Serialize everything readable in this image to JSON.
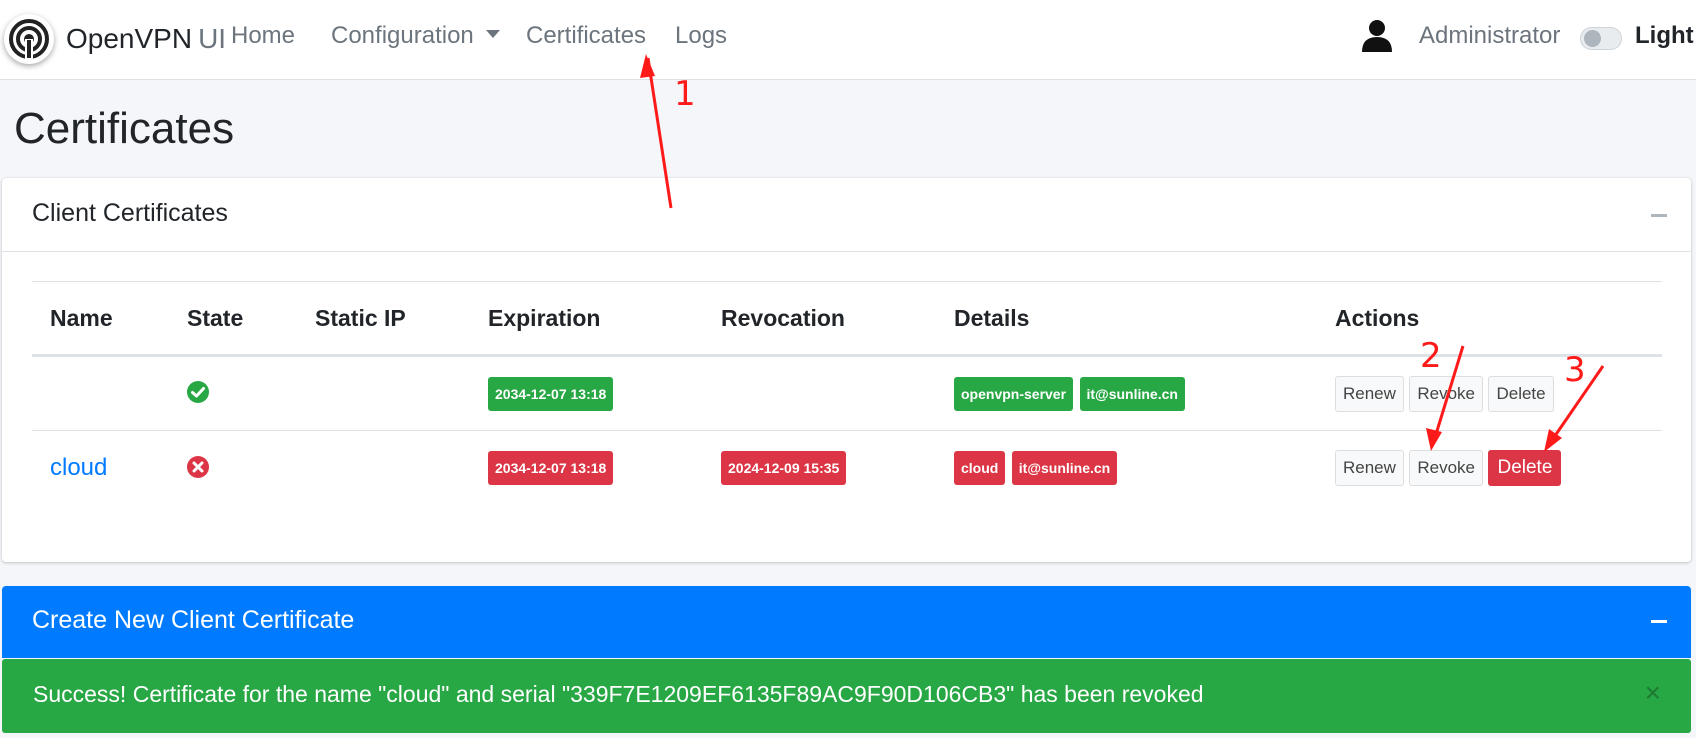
{
  "navbar": {
    "brand_name": "OpenVPN",
    "brand_suffix": "UI",
    "nav_items": {
      "home": "Home",
      "configuration": "Configuration",
      "certificates": "Certificates",
      "logs": "Logs"
    },
    "user_name": "Administrator",
    "theme_toggle_label": "Light"
  },
  "page": {
    "title": "Certificates"
  },
  "client_certificates": {
    "title": "Client Certificates",
    "columns": [
      "Name",
      "State",
      "Static IP",
      "Expiration",
      "Revocation",
      "Details",
      "Actions"
    ],
    "rows": [
      {
        "name": "",
        "state": "valid",
        "state_icon": "check-circle-icon",
        "static_ip": "",
        "expiration": "2034-12-07 13:18",
        "revocation": "",
        "details": [
          "openvpn-server",
          "it@sunline.cn"
        ],
        "actions": [
          "Renew",
          "Revoke",
          "Delete"
        ]
      },
      {
        "name": "cloud",
        "state": "revoked",
        "state_icon": "times-circle-icon",
        "static_ip": "",
        "expiration": "2034-12-07 13:18",
        "revocation": "2024-12-09 15:35",
        "details": [
          "cloud",
          "it@sunline.cn"
        ],
        "actions": [
          "Renew",
          "Revoke",
          "Delete"
        ]
      }
    ]
  },
  "create_certificate": {
    "title": "Create New Client Certificate"
  },
  "alert": {
    "message": "Success! Certificate for the name \"cloud\" and serial \"339F7E1209EF6135F89AC9F90D106CB3\" has been revoked",
    "close_symbol": "×"
  },
  "annotations": {
    "labels": [
      "1",
      "2",
      "3"
    ],
    "color": "#ff1a1a"
  },
  "colors": {
    "primary": "#007bff",
    "success": "#28a745",
    "danger": "#dc3545"
  }
}
